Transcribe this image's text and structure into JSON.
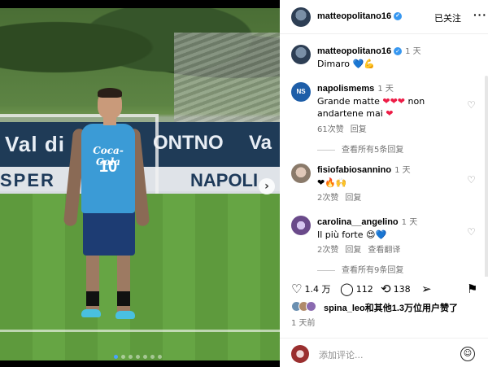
{
  "post": {
    "photo": {
      "board_text_left": "Val di Sole",
      "board_text_mid": "ONTNO",
      "board_text_right": "Va",
      "board2_text_left": "SPER",
      "board2_text_right": "NAPOLI",
      "jersey_sponsor": "Coca-Cola",
      "jersey_number": "10",
      "next_glyph": "›",
      "carousel_count": 7,
      "carousel_active_index": 0
    }
  },
  "header": {
    "username": "matteopolitano16",
    "verified_glyph": "✓",
    "follow_label": "已关注",
    "more_glyph": "···"
  },
  "caption": {
    "username": "matteopolitano16",
    "time": "1 天",
    "text": "Dimaro",
    "emoji": "💙💪"
  },
  "comments": [
    {
      "username": "napolismems",
      "time": "1 天",
      "text_a": "Grande matte",
      "hearts_a": "❤❤❤",
      "text_b": "non andartene mai",
      "hearts_b": "❤",
      "likes": "61次赞",
      "reply": "回复",
      "avatar_text": "NS",
      "view_replies": "查看所有5条回复"
    },
    {
      "username": "fisiofabiosannino",
      "time": "1 天",
      "text": "❤🔥🙌",
      "likes": "2次赞",
      "reply": "回复"
    },
    {
      "username": "carolina__angelino",
      "time": "1 天",
      "text": "Il più forte",
      "emoji": "😍💙",
      "likes": "2次赞",
      "reply": "回复",
      "translate": "查看翻译",
      "view_replies": "查看所有9条回复"
    }
  ],
  "actions": {
    "like_count": "1.4 万",
    "comment_count": "112",
    "share_count": "138"
  },
  "likes_summary": {
    "user": "spina_leo",
    "text": "和其他1.3万位用户赞了"
  },
  "posted": "1 天前",
  "add_comment_placeholder": "添加评论...",
  "colors": {
    "verified": "#3797f0",
    "heart_red": "#ed1c46",
    "heart_blue": "#2f7fd9",
    "muted": "#737373"
  }
}
